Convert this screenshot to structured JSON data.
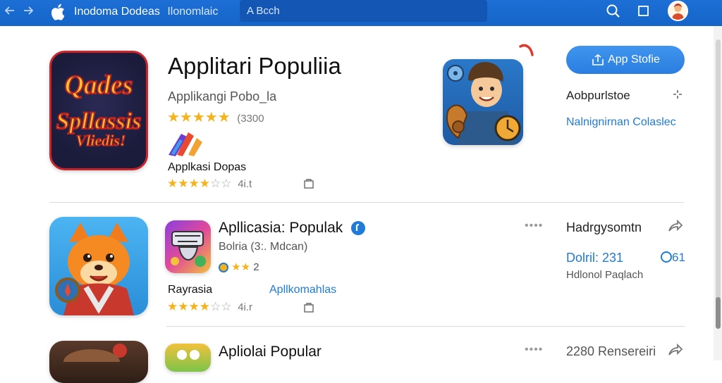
{
  "window": {
    "title": "Inodoma Dodeas",
    "subtitle": "Ilonomlaic"
  },
  "toolbar": {
    "back_icon": "back-arrow-icon",
    "forward_icon": "forward-arrow-icon",
    "search_placeholder": "A Bcch",
    "search_icon": "search-icon",
    "window_icon": "square-window-icon"
  },
  "featured": {
    "icon_text_lines": [
      "Qades",
      "Spllassis",
      "Vliedis!"
    ],
    "title": "Applitari Populiia",
    "subtitle": "Applikangi Pobo_la",
    "rating_stars": 5,
    "rating_count": "(3300",
    "secondary_label": "Applkasi Dopas",
    "secondary_stars": 4,
    "secondary_count": "4i.t",
    "app_store_button": "App Stofie",
    "store_label": "Aobpurlstoe",
    "link_text": "Nalnignirnan Colaslec"
  },
  "rows": [
    {
      "title": "Apllicasia: Populak",
      "subtitle": "Bolria (3:. Mdcan)",
      "mini_rating": "2",
      "label_left": "Rayrasia",
      "label_right": "Apllkomahlas",
      "stars": 4,
      "count": "4i.r",
      "right_title": "Hadrgysomtn",
      "right_price": "Dolril: 231",
      "right_badge": "61",
      "right_sub": "Hdlonol Paqlach"
    },
    {
      "title": "Apliolai Popular",
      "right_title": "2280 Rensereiri"
    }
  ],
  "colors": {
    "topbar": "#1565c8",
    "accent": "#1f7ad8",
    "star": "#f6b21a"
  }
}
